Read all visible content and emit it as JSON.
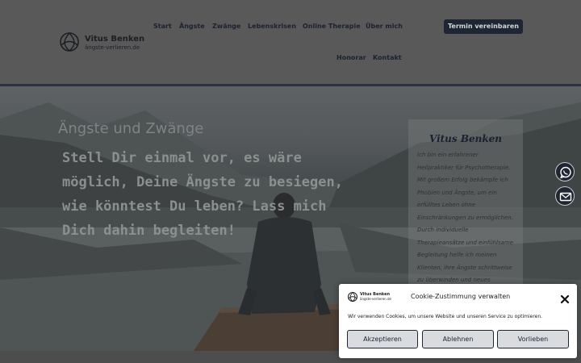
{
  "header": {
    "logo": {
      "name": "Vitus Benken",
      "domain": "ängste-verlieren.de"
    },
    "nav": [
      "Start",
      "Ängste",
      "Zwänge",
      "Lebenskrisen",
      "Online Therapie",
      "Über mich",
      "Honorar",
      "Kontakt"
    ],
    "cta_label": "Termin vereinbaren"
  },
  "hero": {
    "kicker": "Ängste und Zwänge",
    "title": "Stell Dir einmal vor, es wäre möglich, Deine Ängste zu besiegen, wie könntest Du leben? Lass mich Dich dahin begleiten!"
  },
  "bio": {
    "name": "Vitus Benken",
    "text": "Ich bin ein erfahrener Heilpraktiker für Psychotherapie. Mit großem Erfolg bekämpfe ich Phobien und Ängste, um ein erfülltes Leben ohne Einschränkungen zu ermöglichen. Durch individuelle Therapieansätze und einfühlsame Begleitung helfe ich meinen Klienten, ihre Ängste schrittweise zu überwinden und neues Selbstvertrauen"
  },
  "side_buttons": {
    "whatsapp": "whatsapp-icon",
    "mail": "envelope-icon"
  },
  "cookie": {
    "logo": {
      "name": "Vitus Benken",
      "domain": "ängste-verlieren.de"
    },
    "title": "Cookie-Zustimmung verwalten",
    "text": "Wir verwenden Cookies, um unsere Website und unseren Service zu optimieren.",
    "accept": "Akzeptieren",
    "reject": "Ablehnen",
    "preferences": "Vorlieben"
  },
  "colors": {
    "brand_dark": "#1f2633",
    "header_bg": "#595959",
    "button_bg": "#d9dbdf"
  }
}
